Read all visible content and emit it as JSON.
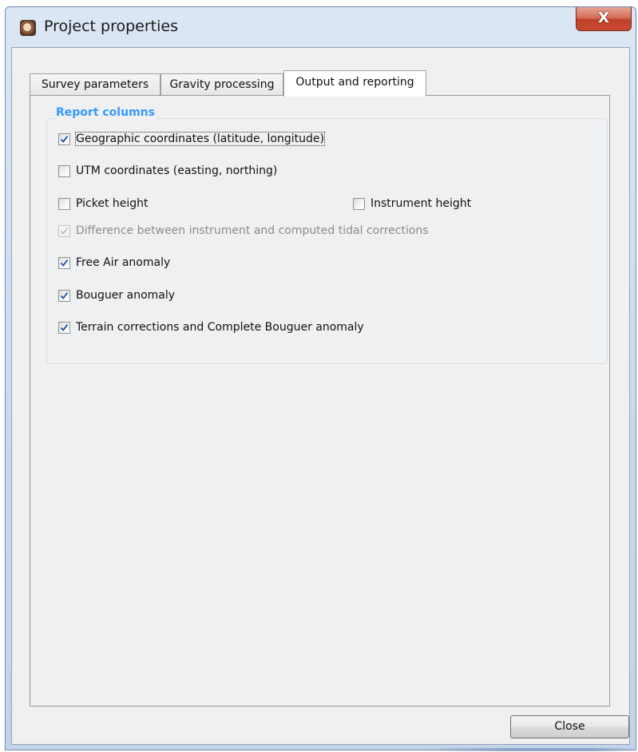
{
  "window": {
    "title": "Project properties",
    "close_glyph": "X",
    "app_icon": "project-app-icon"
  },
  "tabs": [
    {
      "label": "Survey parameters",
      "active": false
    },
    {
      "label": "Gravity processing",
      "active": false
    },
    {
      "label": "Output and reporting",
      "active": true
    }
  ],
  "report_columns": {
    "title": "Report columns",
    "options": [
      {
        "label": "Geographic coordinates (latitude, longitude)",
        "checked": true,
        "enabled": true
      },
      {
        "label": "UTM coordinates (easting, northing)",
        "checked": false,
        "enabled": true
      },
      {
        "label": "Picket height",
        "checked": false,
        "enabled": true
      },
      {
        "label": "Instrument height",
        "checked": false,
        "enabled": true
      },
      {
        "label": "Difference between instrument and computed tidal corrections",
        "checked": true,
        "enabled": false
      },
      {
        "label": "Free Air anomaly",
        "checked": true,
        "enabled": true
      },
      {
        "label": "Bouguer anomaly",
        "checked": true,
        "enabled": true
      },
      {
        "label": "Terrain corrections and Complete Bouguer anomaly",
        "checked": true,
        "enabled": true
      }
    ]
  },
  "footer": {
    "close_label": "Close"
  },
  "colors": {
    "group_title": "#3399ff",
    "title_close_button": "#c94a31",
    "check_mark": "#1f4fa8"
  }
}
